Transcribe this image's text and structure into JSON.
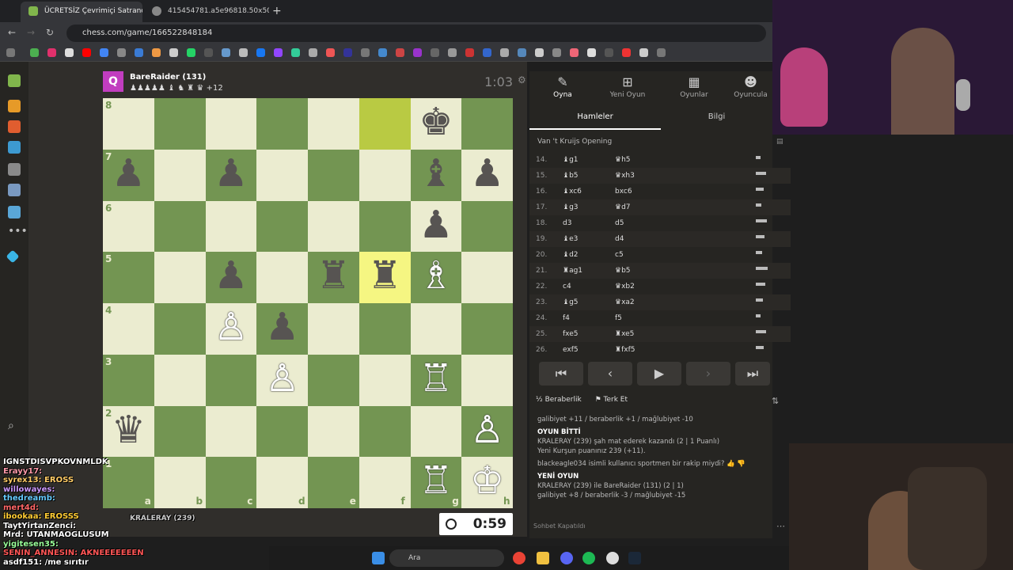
{
  "browser": {
    "tabs": [
      {
        "label": "ÜCRETSİZ Çevrimiçi Satranç",
        "active": true
      },
      {
        "label": "415454781.a5e96818.50x50o.4",
        "active": false
      }
    ],
    "url": "chess.com/game/166522848184",
    "new_tab": "+"
  },
  "game": {
    "top_player": {
      "avatar_letter": "Q",
      "name": "BareRaider (131)",
      "captured": "♟♟♟♟♟ ♝ ♞ ♜ ♛ +12",
      "clock": "1:03"
    },
    "bottom_player": {
      "name": "KRALERAY (239)",
      "clock": "0:59"
    },
    "files": [
      "a",
      "b",
      "c",
      "d",
      "e",
      "f",
      "g",
      "h"
    ],
    "ranks": [
      "8",
      "7",
      "6",
      "5",
      "4",
      "3",
      "2",
      "1"
    ]
  },
  "panel": {
    "tabs": [
      {
        "label": "Oyna",
        "icon": "play-icon"
      },
      {
        "label": "Yeni Oyun",
        "icon": "plus-icon"
      },
      {
        "label": "Oyunlar",
        "icon": "board-icon"
      },
      {
        "label": "Oyuncula",
        "icon": "players-icon"
      }
    ],
    "subtabs": [
      "Hamleler",
      "Bilgi"
    ],
    "opening": "Van 't Kruijs Opening",
    "moves": [
      {
        "n": "14.",
        "w": "♝g1",
        "b": "♛h5"
      },
      {
        "n": "15.",
        "w": "♝b5",
        "b": "♛xh3"
      },
      {
        "n": "16.",
        "w": "♝xc6",
        "b": "bxc6"
      },
      {
        "n": "17.",
        "w": "♝g3",
        "b": "♛d7"
      },
      {
        "n": "18.",
        "w": "d3",
        "b": "d5"
      },
      {
        "n": "19.",
        "w": "♝e3",
        "b": "d4"
      },
      {
        "n": "20.",
        "w": "♝d2",
        "b": "c5"
      },
      {
        "n": "21.",
        "w": "♜ag1",
        "b": "♛b5"
      },
      {
        "n": "22.",
        "w": "c4",
        "b": "♛xb2"
      },
      {
        "n": "23.",
        "w": "♝g5",
        "b": "♛xa2"
      },
      {
        "n": "24.",
        "w": "f4",
        "b": "f5"
      },
      {
        "n": "25.",
        "w": "fxe5",
        "b": "♜xe5"
      },
      {
        "n": "26.",
        "w": "exf5",
        "b": "♜fxf5"
      }
    ],
    "nav": [
      "⏮",
      "‹",
      "▶",
      "›",
      "⏭"
    ],
    "draw_label": "½ Beraberlik",
    "resign_label": "⚑ Terk Et",
    "chat": {
      "line1": "galibiyet +11 / beraberlik +1 / mağlubiyet -10",
      "over_title": "OYUN BİTTİ",
      "over_text": "KRALERAY (239) şah mat ederek kazandı (2 | 1 Puanlı)",
      "rating": "Yeni Kurşun puanınız 239 (+11).",
      "sportsman": "blackeagle034 isimli kullanıcı sportmen bir rakip miydi?",
      "new_title": "YENİ OYUN",
      "new_text": "KRALERAY (239) ile BareRaider (131) (2 | 1)",
      "new_stats": "galibiyet +8 / beraberlik -3 / mağlubiyet -15",
      "closed": "Sohbet Kapatıldı"
    }
  },
  "stream_chat": [
    "IGNSTDISVPKOVNMLDK",
    "Erayy17: ",
    "syrex13: EROSS",
    "willowayes: ",
    "thedreamb: ",
    "mert4d: ",
    "ibookaa: EROSSS",
    "TaytYirtanZenci: ",
    "Mrd: UTANMAOGLUSUM",
    "yigitesen35: ",
    "SENIN_ANNESIN: AKNEEEEEEEN",
    "asdf151: /me sırıtır"
  ],
  "taskbar": {
    "search_label": "Ara"
  },
  "colors": {
    "light_square": "#ebecd0",
    "dark_square": "#739552",
    "highlight": "#f5f682",
    "accent": "#81b64c"
  }
}
